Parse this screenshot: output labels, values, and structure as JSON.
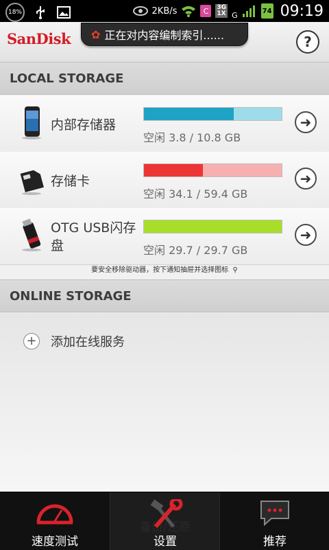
{
  "status_bar": {
    "battery_percent": "18%",
    "speed": "2KB/s",
    "network_3g": "3G",
    "network_1x": "1X",
    "network_g": "G",
    "battery_level": "74",
    "time": "09:19"
  },
  "header": {
    "logo": "SanDisk",
    "help": "?",
    "toast": "正在对内容编制索引......"
  },
  "local_storage": {
    "title": "LOCAL STORAGE",
    "items": [
      {
        "name": "内部存储器",
        "free": "空闲 3.8 / 10.8 GB",
        "used_fraction": 0.65,
        "fill_color": "#1fa3c4",
        "track_color": "#9fdcea"
      },
      {
        "name": "存储卡",
        "free": "空闲 34.1 / 59.4 GB",
        "used_fraction": 0.43,
        "fill_color": "#ee3535",
        "track_color": "#f7b0b0"
      },
      {
        "name": "OTG USB闪存盘",
        "free": "空闲 29.7 / 29.7 GB",
        "used_fraction": 1.0,
        "fill_color": "#a8de2a",
        "track_color": "#d8f19a"
      }
    ],
    "eject_tip": "要安全移除驱动器，按下通知抽屉并选择图标"
  },
  "online_storage": {
    "title": "ONLINE STORAGE",
    "add_label": "添加在线服务"
  },
  "bottom_tabs": {
    "speed_test": "速度测试",
    "settings": "设置",
    "settings_ghost": "备份/还原",
    "recommend": "推荐"
  },
  "colors": {
    "brand": "#d21c26",
    "internal_bar": "#1fa3c4",
    "card_bar": "#ee3535",
    "otg_bar": "#a8de2a"
  }
}
